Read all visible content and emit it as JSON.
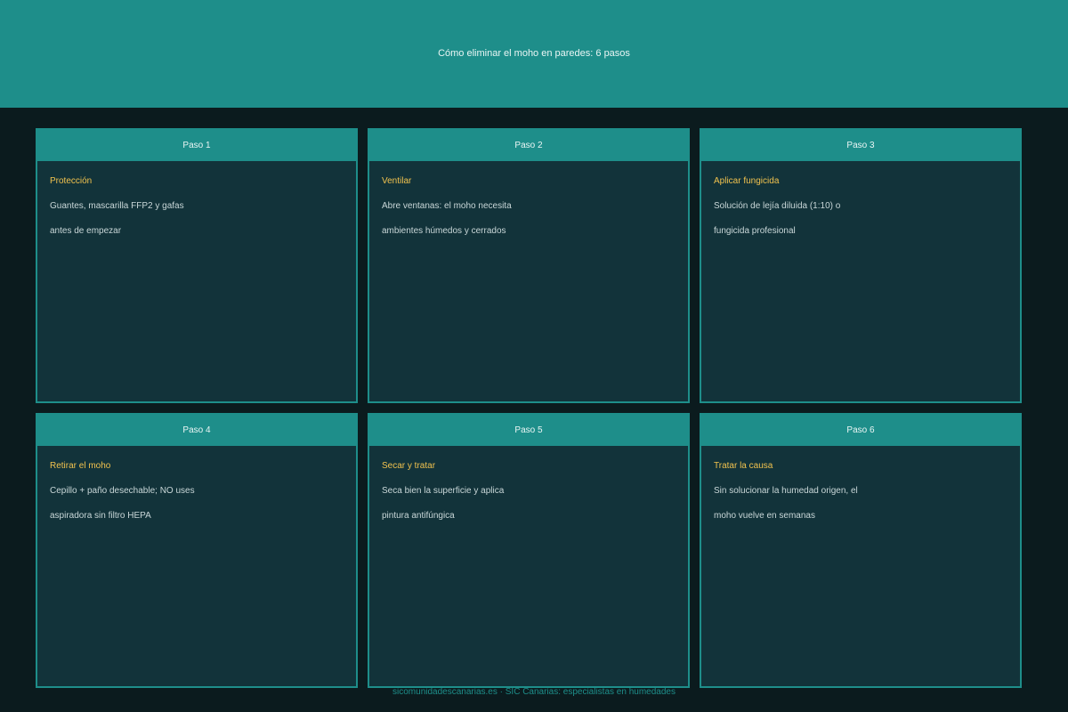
{
  "header": {
    "title": "Cómo eliminar el moho en paredes: 6 pasos"
  },
  "steps": [
    {
      "label": "Paso 1",
      "title": "Protección",
      "lines": [
        "Guantes, mascarilla FFP2 y gafas",
        "antes de empezar"
      ]
    },
    {
      "label": "Paso 2",
      "title": "Ventilar",
      "lines": [
        "Abre ventanas: el moho necesita",
        "ambientes húmedos y cerrados"
      ]
    },
    {
      "label": "Paso 3",
      "title": "Aplicar fungicida",
      "lines": [
        "Solución de lejía diluida (1:10) o",
        "fungicida profesional"
      ]
    },
    {
      "label": "Paso 4",
      "title": "Retirar el moho",
      "lines": [
        "Cepillo + paño desechable; NO uses",
        "aspiradora sin filtro HEPA"
      ]
    },
    {
      "label": "Paso 5",
      "title": "Secar y tratar",
      "lines": [
        "Seca bien la superficie y aplica",
        "pintura antifúngica"
      ]
    },
    {
      "label": "Paso 6",
      "title": "Tratar la causa",
      "lines": [
        "Sin solucionar la humedad origen, el",
        "moho vuelve en semanas"
      ]
    }
  ],
  "footer": {
    "text": "sicomunidadescanarias.es · SIC Canarias: especialistas en humedades"
  },
  "colors": {
    "accent": "#1e8e8a",
    "background": "#0b1b1e",
    "card_bg": "#12333a",
    "step_title": "#f1c24e"
  }
}
